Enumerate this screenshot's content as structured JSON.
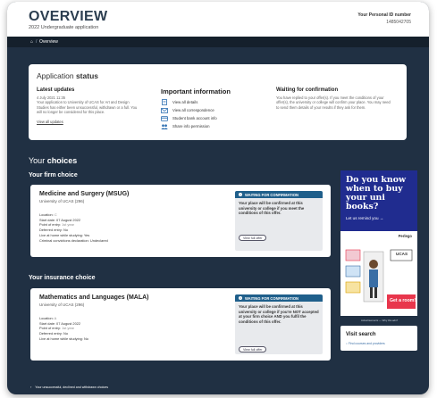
{
  "header": {
    "title": "OVERVIEW",
    "subtitle": "2022 Undergraduate application",
    "pid_label": "Your Personal ID number",
    "pid_value": "1485042705"
  },
  "breadcrumb": {
    "home_icon": "home-icon",
    "separator": "/",
    "current": "Overview"
  },
  "status": {
    "title_light": "Application ",
    "title_bold": "status",
    "latest": {
      "heading": "Latest updates",
      "date": "4 July 2021 11:35",
      "message": "Your application to University of UCAS for Art and Design Studies has either been unsuccessful, withdrawn or a full. You will no longer be considered for this place.",
      "link": "View all updates"
    },
    "important": {
      "heading": "Important information",
      "items": [
        {
          "icon": "document-icon",
          "label": "View all details"
        },
        {
          "icon": "mail-icon",
          "label": "View all correspondence"
        },
        {
          "icon": "card-icon",
          "label": "Student bank account info"
        },
        {
          "icon": "people-icon",
          "label": "Share info permission"
        }
      ]
    },
    "waiting": {
      "heading": "Waiting for confirmation",
      "message": "You have replied to your offer(s). If you meet the conditions of your offer(s), the university or college will confirm your place. You may need to send them details of your results if they ask for them."
    }
  },
  "choices": {
    "heading_light": "Your ",
    "heading_bold": "choices",
    "firm": {
      "section_title": "Your firm choice",
      "course": "Medicine and Surgery (MSUG)",
      "university": "University of UCAS (296)",
      "details": [
        {
          "label": "Location:",
          "value": "C",
          "muted": true
        },
        {
          "label": "Start date:",
          "value": "07 August 2022",
          "muted": false
        },
        {
          "label": "Point of entry:",
          "value": "1st year",
          "muted": true
        },
        {
          "label": "Deferred entry:",
          "value": "No",
          "muted": false
        },
        {
          "label": "Live at home while studying:",
          "value": "Yes",
          "muted": false
        },
        {
          "label": "Criminal convictions declaration:",
          "value": "Undeclared",
          "muted": false
        }
      ],
      "status_label": "WAITING FOR CONFIRMATION",
      "status_message": "Your place will be confirmed at this university or college if you meet the conditions of this offer.",
      "button": "View full offer"
    },
    "insurance": {
      "section_title": "Your insurance choice",
      "course": "Mathematics and Languages (MALA)",
      "university": "University of UCAS (296)",
      "details": [
        {
          "label": "Location:",
          "value": "A",
          "muted": true
        },
        {
          "label": "Start date:",
          "value": "07 August 2022",
          "muted": false
        },
        {
          "label": "Point of entry:",
          "value": "1st year",
          "muted": true
        },
        {
          "label": "Deferred entry:",
          "value": "No",
          "muted": false
        },
        {
          "label": "Live at home while studying:",
          "value": "No",
          "muted": false
        }
      ],
      "status_label": "WAITING FOR CONFIRMATION",
      "status_message": "Your place will be confirmed at this university or college if you're NOT accepted at your firm choice AND you fulfil the conditions of this offer.",
      "button": "View full offer"
    },
    "unsuccessful": "Your unsuccessful, declined and withdrawn choices"
  },
  "ads": {
    "ad1": {
      "question": "Do you know when to buy your uni books?",
      "cta": "Let us remind you →",
      "brand": "Perlego",
      "caption": "Advertisements — Why this ads?"
    },
    "ad2": {
      "logo": "UCAS",
      "sign": "Get a room!",
      "caption": "Advertisements — Why this ads?"
    }
  },
  "visit": {
    "title": "Visit search",
    "link": "Find courses and providers"
  },
  "colors": {
    "page_bg": "#203043",
    "accent": "#1f5f8b",
    "ad_blue": "#202c8f",
    "ad_red": "#e8364c"
  }
}
